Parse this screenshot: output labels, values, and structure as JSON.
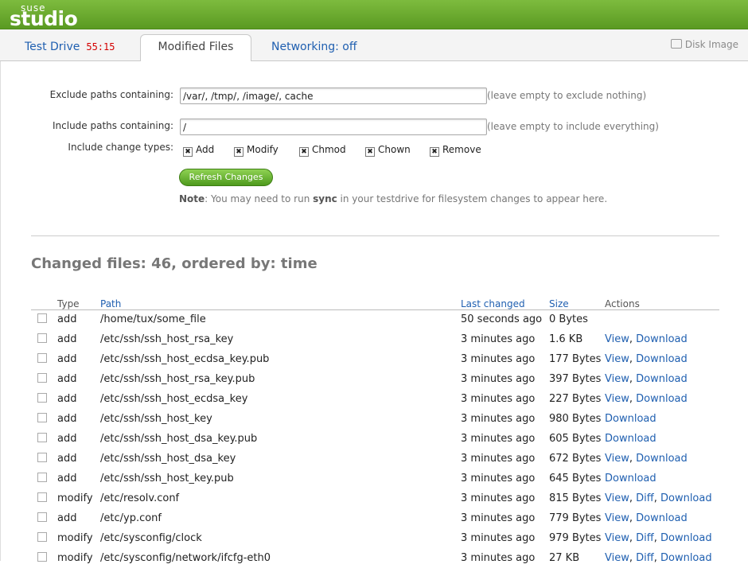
{
  "brand": {
    "suse": "SUSE",
    "studio": "studio"
  },
  "tabs": {
    "test_drive": "Test Drive",
    "timer": "55:15",
    "modified_files": "Modified Files",
    "networking": "Networking: off",
    "disk_image": "Disk Image"
  },
  "filters": {
    "exclude_label": "Exclude paths containing:",
    "exclude_value": "/var/, /tmp/, /image/, cache",
    "exclude_hint": "(leave empty to exclude nothing)",
    "include_label": "Include paths containing:",
    "include_value": "/",
    "include_hint": "(leave empty to include everything)",
    "change_types_label": "Include change types:",
    "change_types": [
      "Add",
      "Modify",
      "Chmod",
      "Chown",
      "Remove"
    ],
    "refresh_button": "Refresh Changes",
    "note_label": "Note",
    "note_prefix": ": You may need to run ",
    "note_command": "sync",
    "note_suffix": " in your testdrive for filesystem changes to appear here."
  },
  "results": {
    "heading": "Changed files: 46, ordered by: time",
    "columns": {
      "type": "Type",
      "path": "Path",
      "last_changed": "Last changed",
      "size": "Size",
      "actions": "Actions"
    },
    "rows": [
      {
        "type": "add",
        "path": "/home/tux/some_file",
        "time": "50 seconds ago",
        "size": "0 Bytes",
        "actions": []
      },
      {
        "type": "add",
        "path": "/etc/ssh/ssh_host_rsa_key",
        "time": "3 minutes ago",
        "size": "1.6 KB",
        "actions": [
          "View",
          "Download"
        ]
      },
      {
        "type": "add",
        "path": "/etc/ssh/ssh_host_ecdsa_key.pub",
        "time": "3 minutes ago",
        "size": "177 Bytes",
        "actions": [
          "View",
          "Download"
        ]
      },
      {
        "type": "add",
        "path": "/etc/ssh/ssh_host_rsa_key.pub",
        "time": "3 minutes ago",
        "size": "397 Bytes",
        "actions": [
          "View",
          "Download"
        ]
      },
      {
        "type": "add",
        "path": "/etc/ssh/ssh_host_ecdsa_key",
        "time": "3 minutes ago",
        "size": "227 Bytes",
        "actions": [
          "View",
          "Download"
        ]
      },
      {
        "type": "add",
        "path": "/etc/ssh/ssh_host_key",
        "time": "3 minutes ago",
        "size": "980 Bytes",
        "actions": [
          "Download"
        ]
      },
      {
        "type": "add",
        "path": "/etc/ssh/ssh_host_dsa_key.pub",
        "time": "3 minutes ago",
        "size": "605 Bytes",
        "actions": [
          "Download"
        ]
      },
      {
        "type": "add",
        "path": "/etc/ssh/ssh_host_dsa_key",
        "time": "3 minutes ago",
        "size": "672 Bytes",
        "actions": [
          "View",
          "Download"
        ]
      },
      {
        "type": "add",
        "path": "/etc/ssh/ssh_host_key.pub",
        "time": "3 minutes ago",
        "size": "645 Bytes",
        "actions": [
          "Download"
        ]
      },
      {
        "type": "modify",
        "path": "/etc/resolv.conf",
        "time": "3 minutes ago",
        "size": "815 Bytes",
        "actions": [
          "View",
          "Diff",
          "Download"
        ]
      },
      {
        "type": "add",
        "path": "/etc/yp.conf",
        "time": "3 minutes ago",
        "size": "779 Bytes",
        "actions": [
          "View",
          "Download"
        ]
      },
      {
        "type": "modify",
        "path": "/etc/sysconfig/clock",
        "time": "3 minutes ago",
        "size": "979 Bytes",
        "actions": [
          "View",
          "Diff",
          "Download"
        ]
      },
      {
        "type": "modify",
        "path": "/etc/sysconfig/network/ifcfg-eth0",
        "time": "3 minutes ago",
        "size": "27 KB",
        "actions": [
          "View",
          "Diff",
          "Download"
        ]
      }
    ]
  },
  "colors": {
    "brand_green": "#6aab2e",
    "link": "#1f5fb0",
    "timer": "#d40000"
  }
}
